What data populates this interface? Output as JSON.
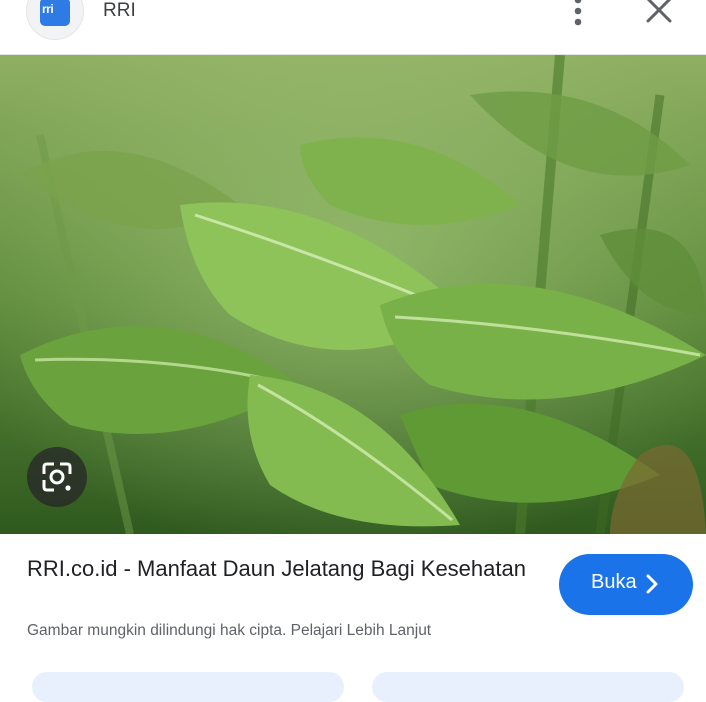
{
  "header": {
    "site_name": "RRI",
    "logo_text": "rri"
  },
  "result": {
    "title": "RRI.co.id - Manfaat Daun Jelatang Bagi Kesehatan",
    "copyright_notice": "Gambar mungkin dilindungi hak cipta.",
    "learn_more": "Pelajari Lebih Lanjut",
    "open_label": "Buka"
  },
  "colors": {
    "accent": "#1a73e8",
    "text": "#202124",
    "muted": "#5f6368"
  },
  "icons": {
    "more": "more-vert-icon",
    "close": "close-icon",
    "lens": "lens-icon",
    "open": "chevron-right-icon"
  }
}
